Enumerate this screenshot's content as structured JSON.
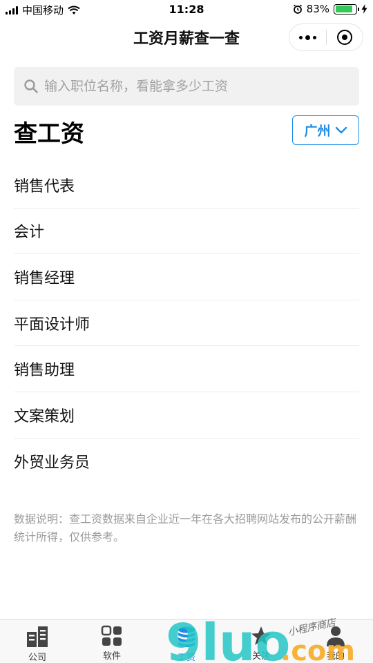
{
  "status_bar": {
    "carrier": "中国移动",
    "time": "11:28",
    "battery_percent": "83%",
    "battery_level": 0.83
  },
  "nav": {
    "title": "工资月薪查一查"
  },
  "search": {
    "placeholder": "输入职位名称，看能拿多少工资"
  },
  "header": {
    "title": "查工资",
    "city": "广州"
  },
  "jobs": [
    "销售代表",
    "会计",
    "销售经理",
    "平面设计师",
    "销售助理",
    "文案策划",
    "外贸业务员"
  ],
  "note": "数据说明：查工资数据来自企业近一年在各大招聘网站发布的公开薪酬统计所得，仅供参考。",
  "tabs": [
    {
      "label": "公司",
      "icon": "building-icon",
      "active": false
    },
    {
      "label": "软件",
      "icon": "grid-icon",
      "active": false
    },
    {
      "label": "工资",
      "icon": "coins-icon",
      "active": true
    },
    {
      "label": "关注",
      "icon": "star-icon",
      "active": false
    },
    {
      "label": "我的",
      "icon": "user-icon",
      "active": false
    }
  ],
  "watermark": {
    "brand": "9luo",
    "domain": ".com",
    "tagline": "小程序商店"
  },
  "colors": {
    "accent": "#1f8de6",
    "watermark_teal": "#25c6c6",
    "watermark_orange": "#f7a823"
  }
}
